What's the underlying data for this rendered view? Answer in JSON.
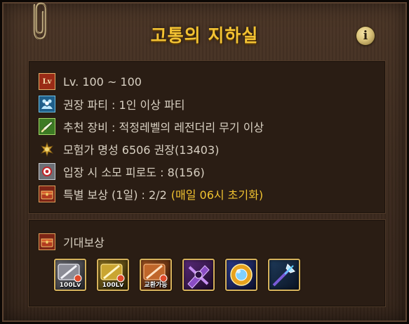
{
  "dungeon": {
    "title": "고통의 지하실",
    "info_icon_glyph": "i"
  },
  "info": {
    "level": {
      "icon": "level-icon",
      "icon_text": "Lv",
      "text": "Lv. 100 ~ 100"
    },
    "party": {
      "icon": "party-icon",
      "text": "권장 파티 : 1인 이상 파티"
    },
    "equipment": {
      "icon": "weapon-icon",
      "text": "추천 장비 : 적정레벨의 레전더리 무기 이상"
    },
    "fame": {
      "icon": "fame-emblem-icon",
      "text": "모험가 명성 6506 권장(13403)"
    },
    "fatigue": {
      "icon": "fatigue-icon",
      "text": "입장 시 소모 피로도 : 8(156)"
    },
    "special_reward": {
      "icon": "treasure-chest-icon",
      "text": "특별 보상 (1일) : 2/2",
      "note": "(매일 06시 초기화)",
      "note_color": "#f0c230"
    }
  },
  "rewards": {
    "header_icon": "treasure-chest-icon",
    "label": "기대보상",
    "items": [
      {
        "name": "level-100-weapon-box-silver",
        "caption": "100Lv"
      },
      {
        "name": "level-100-weapon-box-gold",
        "caption": "100Lv"
      },
      {
        "name": "exchangeable-weapon-box",
        "caption": "교환가능"
      },
      {
        "name": "purple-material-crystal",
        "caption": ""
      },
      {
        "name": "golden-orb",
        "caption": ""
      },
      {
        "name": "blue-spear-shard",
        "caption": ""
      }
    ]
  },
  "colors": {
    "title": "#f2c233",
    "text": "#d8d0c2",
    "highlight": "#f0c230",
    "item_border": "#d6b25c",
    "panel_bg": "#3d2b1f",
    "box_bg": "#2a1d14"
  }
}
